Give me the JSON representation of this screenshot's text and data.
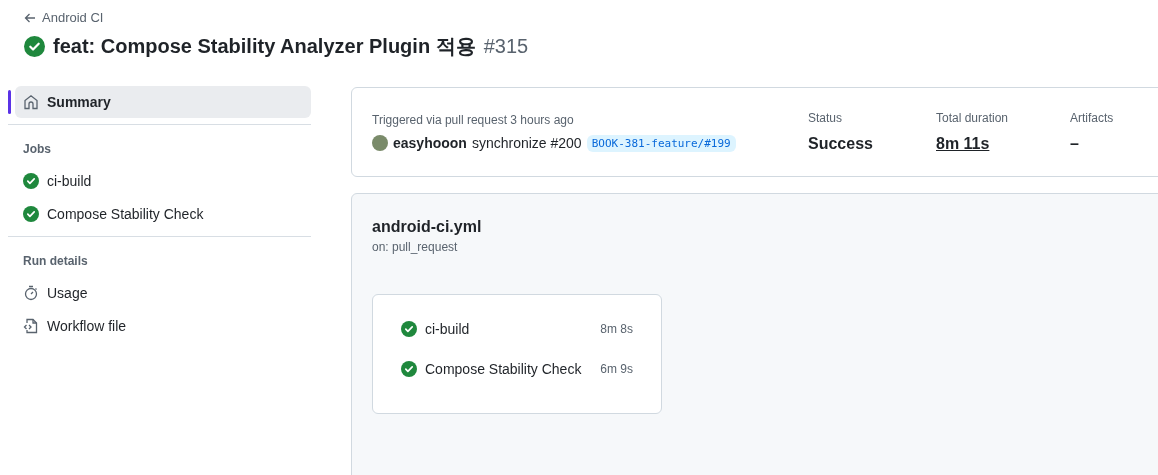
{
  "back_link": "Android CI",
  "run": {
    "passed": true,
    "title": "feat: Compose Stability Analyzer Plugin 적용",
    "number": "#315"
  },
  "sidebar": {
    "summary": {
      "label": "Summary",
      "selected": true
    },
    "sections": [
      {
        "heading": "Jobs",
        "items": [
          {
            "label": "ci-build",
            "kind": "job",
            "passed": true,
            "selected": false
          },
          {
            "label": "Compose Stability Check",
            "kind": "job",
            "passed": true,
            "selected": false
          }
        ]
      },
      {
        "heading": "Run details",
        "items": [
          {
            "label": "Usage",
            "kind": "usage",
            "selected": false
          },
          {
            "label": "Workflow file",
            "kind": "workflow",
            "selected": false
          }
        ]
      }
    ]
  },
  "summary_card": {
    "trigger": "Triggered via pull request 3 hours ago",
    "actor": "easyhooon",
    "event": "synchronize #200",
    "branch": "BOOK-381-feature/#199",
    "stats": [
      {
        "label": "Status",
        "value": "Success",
        "kind": "plain"
      },
      {
        "label": "Total duration",
        "value": "8m 11s",
        "kind": "link"
      },
      {
        "label": "Artifacts",
        "value": "–",
        "kind": "plain"
      }
    ]
  },
  "workflow": {
    "name": "android-ci.yml",
    "trigger": "on: pull_request",
    "jobs": [
      {
        "name": "ci-build",
        "duration": "8m 8s",
        "passed": true
      },
      {
        "name": "Compose Stability Check",
        "duration": "6m 9s",
        "passed": true
      }
    ]
  }
}
